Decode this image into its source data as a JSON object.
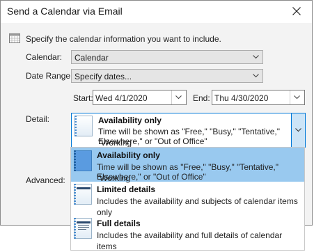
{
  "dialog": {
    "title": "Send a Calendar via Email",
    "instruction": "Specify the calendar information you want to include."
  },
  "calendar": {
    "label": "Calendar:",
    "value": "Calendar"
  },
  "date_range": {
    "label": "Date Range:",
    "value": "Specify dates...",
    "start_label": "Start:",
    "start_value": "Wed 4/1/2020",
    "end_label": "End:",
    "end_value": "Thu 4/30/2020"
  },
  "detail": {
    "label": "Detail:",
    "selected_title": "Availability only",
    "selected_desc_line1": "Time will be shown as \"Free,\" \"Busy,\" \"Tentative,\" \"Working",
    "selected_desc_line2": "Elsewhere,\" or \"Out of Office\""
  },
  "advanced": {
    "label": "Advanced:"
  },
  "dropdown": {
    "options": [
      {
        "title": "Availability only",
        "desc_line1": "Time will be shown as \"Free,\" \"Busy,\" \"Tentative,\" \"Working",
        "desc_line2": "Elsewhere,\" or \"Out of Office\"",
        "icon": "calendar-availability-icon",
        "selected": true
      },
      {
        "title": "Limited details",
        "desc_line1": "Includes the availability and subjects of calendar items only",
        "icon": "calendar-limited-icon",
        "selected": false
      },
      {
        "title": "Full details",
        "desc_line1": "Includes the availability and full details of calendar items",
        "icon": "calendar-full-icon",
        "selected": false
      }
    ]
  },
  "colors": {
    "selection": "#99c9ef",
    "focus_border": "#0078d7",
    "dialog_bg": "#f3f3f3"
  }
}
